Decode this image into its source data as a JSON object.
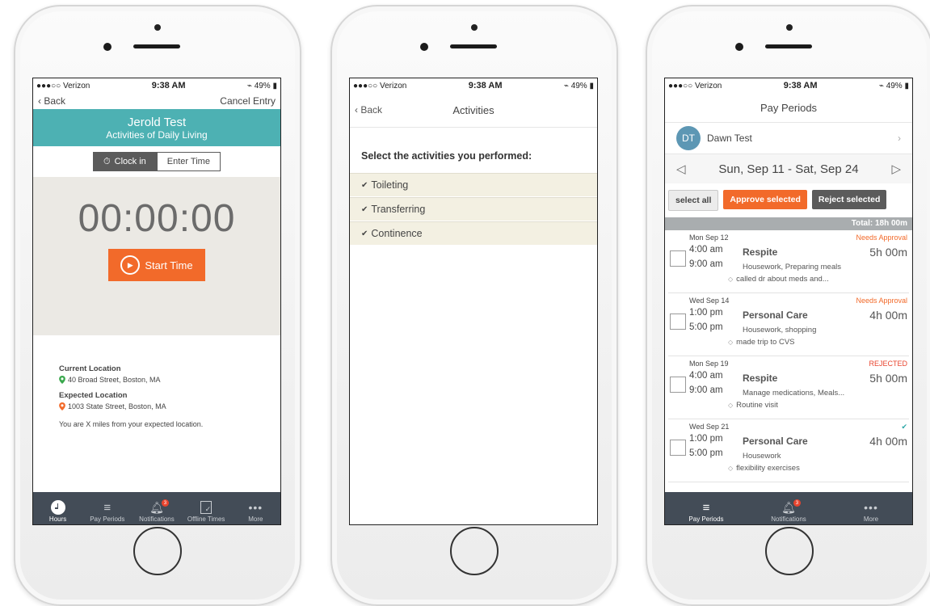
{
  "colors": {
    "teal": "#4db1b3",
    "orange": "#f26a2a",
    "tabbar": "#434c57",
    "reject": "#e8442e",
    "approve_check": "#2aa6a6",
    "needs_approval": "#f26a2a"
  },
  "status": {
    "carrier": "●●●○○ Verizon",
    "time": "9:38 AM",
    "battery": "49%"
  },
  "phone1": {
    "nav": {
      "back": "Back",
      "cancel": "Cancel Entry"
    },
    "header": {
      "name": "Jerold Test",
      "subtitle": "Activities of Daily Living"
    },
    "segment": {
      "clock_in": "Clock in",
      "enter_time": "Enter Time"
    },
    "timer": "00:00:00",
    "start_label": "Start Time",
    "location": {
      "current_label": "Current Location",
      "current": "40 Broad Street, Boston, MA",
      "expected_label": "Expected Location",
      "expected": "1003 State Street, Boston, MA",
      "distance": "You are X miles from your expected location."
    },
    "tabs": [
      {
        "label": "Hours",
        "icon": "clock-icon"
      },
      {
        "label": "Pay Periods",
        "icon": "list-icon"
      },
      {
        "label": "Notifications",
        "icon": "bell-icon",
        "badge": "3"
      },
      {
        "label": "Offline Times",
        "icon": "checklist-icon"
      },
      {
        "label": "More",
        "icon": "more-icon"
      }
    ]
  },
  "phone2": {
    "nav": {
      "back": "Back",
      "title": "Activities"
    },
    "prompt": "Select the activities you performed:",
    "activities": [
      "Toileting",
      "Transferring",
      "Continence"
    ]
  },
  "phone3": {
    "title": "Pay Periods",
    "person": {
      "initials": "DT",
      "name": "Dawn Test"
    },
    "range": "Sun, Sep 11 - Sat, Sep 24",
    "actions": {
      "select_all": "select all",
      "approve": "Approve selected",
      "reject": "Reject selected"
    },
    "total": "Total: 18h 00m",
    "entries": [
      {
        "date": "Mon Sep 12",
        "status": "Needs Approval",
        "start": "4:00 am",
        "end": "9:00 am",
        "type": "Respite",
        "duration": "5h 00m",
        "activities": "Housework, Preparing meals",
        "note": "called dr about meds and..."
      },
      {
        "date": "Wed Sep 14",
        "status": "Needs Approval",
        "start": "1:00 pm",
        "end": "5:00 pm",
        "type": "Personal Care",
        "duration": "4h 00m",
        "activities": "Housework, shopping",
        "note": "made trip to CVS"
      },
      {
        "date": "Mon Sep 19",
        "status": "REJECTED",
        "start": "4:00 am",
        "end": "9:00 am",
        "type": "Respite",
        "duration": "5h 00m",
        "activities": "Manage medications, Meals...",
        "note": "Routine visit"
      },
      {
        "date": "Wed Sep 21",
        "status": "✔",
        "start": "1:00 pm",
        "end": "5:00 pm",
        "type": "Personal Care",
        "duration": "4h 00m",
        "activities": "Housework",
        "note": "flexibility exercises"
      }
    ],
    "tabs": [
      {
        "label": "Pay Periods",
        "icon": "list-icon"
      },
      {
        "label": "Notifications",
        "icon": "bell-icon",
        "badge": "3"
      },
      {
        "label": "More",
        "icon": "more-icon"
      }
    ]
  }
}
